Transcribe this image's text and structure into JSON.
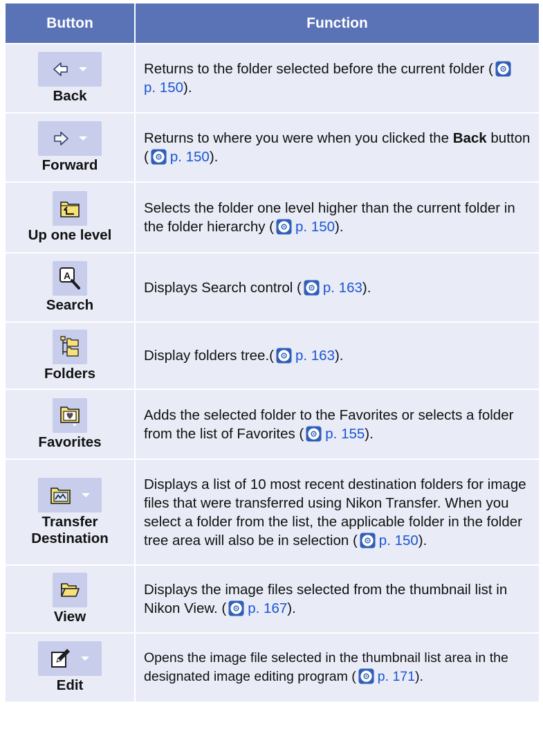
{
  "headers": {
    "button": "Button",
    "function": "Function"
  },
  "rows": [
    {
      "label": "Back",
      "icon": "back-arrow-icon",
      "desc": "Returns to the folder selected before the current folder (",
      "ref": "p. 150",
      "after": ")."
    },
    {
      "label": "Forward",
      "icon": "forward-arrow-icon",
      "desc_pre": "Returns to where you were when you clicked the ",
      "desc_bold": "Back",
      "desc_post": " button (",
      "ref": "p. 150",
      "after": ")."
    },
    {
      "label": "Up one level",
      "icon": "up-folder-icon",
      "desc": "Selects the folder one level higher than the current folder in the folder hierarchy (",
      "ref": "p. 150",
      "after": ")."
    },
    {
      "label": "Search",
      "icon": "search-magnifier-icon",
      "desc": "Displays Search control (",
      "ref": "p. 163",
      "after": ")."
    },
    {
      "label": "Folders",
      "icon": "folder-tree-icon",
      "desc": "Display folders tree.(",
      "ref": "p. 163",
      "after": ")."
    },
    {
      "label": "Favorites",
      "icon": "favorites-folder-icon",
      "desc": "Adds the selected folder to the Favorites or selects a folder from the list of Favorites (",
      "ref_a": "p.",
      "ref_b": "155",
      "after": ")."
    },
    {
      "label_1": "Transfer",
      "label_2": "Destination",
      "icon": "transfer-destination-icon",
      "desc": "Displays a list of 10 most recent destination folders for image files that were transferred using Nikon Transfer. When you select a folder from the list, the applicable folder in the folder tree area will also be in selection (",
      "ref": "p. 150",
      "after": ")."
    },
    {
      "label": "View",
      "icon": "open-folder-icon",
      "desc": "Displays the image files selected from the thumbnail list in Nikon View. (",
      "ref": "p. 167",
      "after": ")."
    },
    {
      "label": "Edit",
      "icon": "edit-pencil-icon",
      "desc": "Opens the image file selected in the thumbnail list area in the designated image editing program (",
      "ref_a": "p.",
      "ref_b": "171",
      "after": ")."
    }
  ],
  "colors": {
    "header_bg": "#5a72b6",
    "row_bg": "#e9ebf6",
    "icon_bg": "#c7cdea",
    "link": "#1a55d4"
  }
}
